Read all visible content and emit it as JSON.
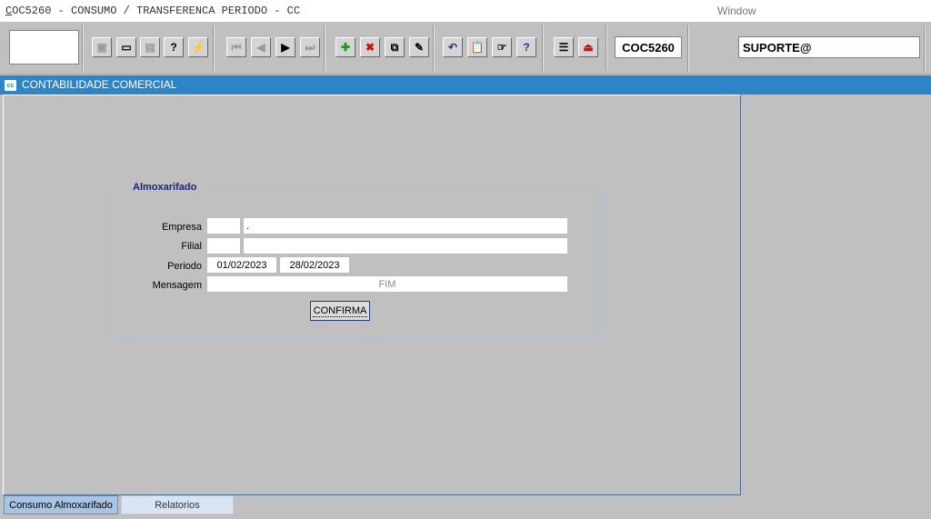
{
  "window": {
    "title_accel": "C",
    "title_rest": "OC5260 - CONSUMO / TRANSFERENCA PERIODO - CC",
    "menu_window": "Window"
  },
  "toolbar": {
    "buttons": [
      {
        "icon": "save-icon",
        "glyph": "▣",
        "disabled": true
      },
      {
        "icon": "screen-icon",
        "glyph": "▭",
        "disabled": false
      },
      {
        "icon": "print-icon",
        "glyph": "▤",
        "disabled": true
      },
      {
        "icon": "query-help-icon",
        "glyph": "?",
        "disabled": false
      },
      {
        "icon": "execute-query-icon",
        "glyph": "⚡",
        "disabled": false
      },
      {
        "icon": "first-record-icon",
        "glyph": "⏮",
        "disabled": true
      },
      {
        "icon": "previous-record-icon",
        "glyph": "◀",
        "disabled": true
      },
      {
        "icon": "next-record-icon",
        "glyph": "▶",
        "disabled": false
      },
      {
        "icon": "last-record-icon",
        "glyph": "⏭",
        "disabled": true
      },
      {
        "icon": "insert-record-icon",
        "glyph": "✚",
        "disabled": false,
        "color": "#1a9a1a"
      },
      {
        "icon": "delete-record-icon",
        "glyph": "✖",
        "disabled": false,
        "color": "#cc1111"
      },
      {
        "icon": "duplicate-record-icon",
        "glyph": "⧉",
        "disabled": false
      },
      {
        "icon": "clear-record-icon",
        "glyph": "✎",
        "disabled": false
      },
      {
        "icon": "undo-icon",
        "glyph": "↶",
        "disabled": false,
        "color": "#1a3a8a"
      },
      {
        "icon": "clipboard-icon",
        "glyph": "📋",
        "disabled": true
      },
      {
        "icon": "list-of-values-icon",
        "glyph": "☞",
        "disabled": false
      },
      {
        "icon": "help-icon",
        "glyph": "?",
        "disabled": false,
        "color": "#1a3a9a"
      },
      {
        "icon": "menu-icon",
        "glyph": "☰",
        "disabled": false
      },
      {
        "icon": "exit-icon",
        "glyph": "⏏",
        "disabled": false,
        "color": "#cc1111"
      }
    ],
    "form_code": "COC5260",
    "user": "SUPORTE@"
  },
  "subtitle": {
    "icon": "app-icon",
    "text": "CONTABILIDADE COMERCIAL"
  },
  "form": {
    "frame_title": "Almoxarifado",
    "empresa_label": "Empresa",
    "empresa_code": "",
    "empresa_name": ".",
    "filial_label": "Filial",
    "filial_code": "",
    "filial_name": "",
    "periodo_label": "Periodo",
    "periodo_inicio": "01/02/2023",
    "periodo_fim": "28/02/2023",
    "mensagem_label": "Mensagem",
    "mensagem_value": "FIM",
    "confirm_label": "CONFIRMA"
  },
  "tabs": [
    {
      "label": "Consumo Almoxarifado",
      "active": true
    },
    {
      "label": "Relatorios",
      "active": false
    }
  ]
}
